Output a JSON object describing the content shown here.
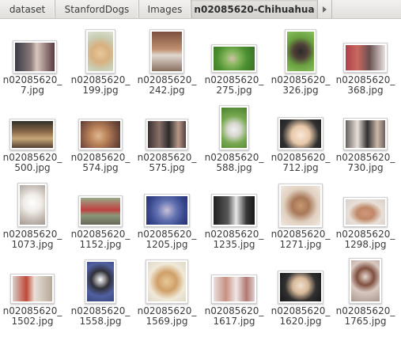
{
  "breadcrumb": {
    "items": [
      {
        "label": "dataset"
      },
      {
        "label": "StanfordDogs"
      },
      {
        "label": "Images"
      },
      {
        "label": "n02085620-Chihuahua"
      }
    ]
  },
  "files": [
    {
      "line1": "n02085620_",
      "line2": "7.jpg"
    },
    {
      "line1": "n02085620_",
      "line2": "199.jpg"
    },
    {
      "line1": "n02085620_",
      "line2": "242.jpg"
    },
    {
      "line1": "n02085620_",
      "line2": "275.jpg"
    },
    {
      "line1": "n02085620_",
      "line2": "326.jpg"
    },
    {
      "line1": "n02085620_",
      "line2": "368.jpg"
    },
    {
      "line1": "n02085620_",
      "line2": "500.jpg"
    },
    {
      "line1": "n02085620_",
      "line2": "574.jpg"
    },
    {
      "line1": "n02085620_",
      "line2": "575.jpg"
    },
    {
      "line1": "n02085620_",
      "line2": "588.jpg"
    },
    {
      "line1": "n02085620_",
      "line2": "712.jpg"
    },
    {
      "line1": "n02085620_",
      "line2": "730.jpg"
    },
    {
      "line1": "n02085620_",
      "line2": "1073.jpg"
    },
    {
      "line1": "n02085620_",
      "line2": "1152.jpg"
    },
    {
      "line1": "n02085620_",
      "line2": "1205.jpg"
    },
    {
      "line1": "n02085620_",
      "line2": "1235.jpg"
    },
    {
      "line1": "n02085620_",
      "line2": "1271.jpg"
    },
    {
      "line1": "n02085620_",
      "line2": "1298.jpg"
    },
    {
      "line1": "n02085620_",
      "line2": "1502.jpg"
    },
    {
      "line1": "n02085620_",
      "line2": "1558.jpg"
    },
    {
      "line1": "n02085620_",
      "line2": "1569.jpg"
    },
    {
      "line1": "n02085620_",
      "line2": "1617.jpg"
    },
    {
      "line1": "n02085620_",
      "line2": "1620.jpg"
    },
    {
      "line1": "n02085620_",
      "line2": "1765.jpg"
    }
  ]
}
